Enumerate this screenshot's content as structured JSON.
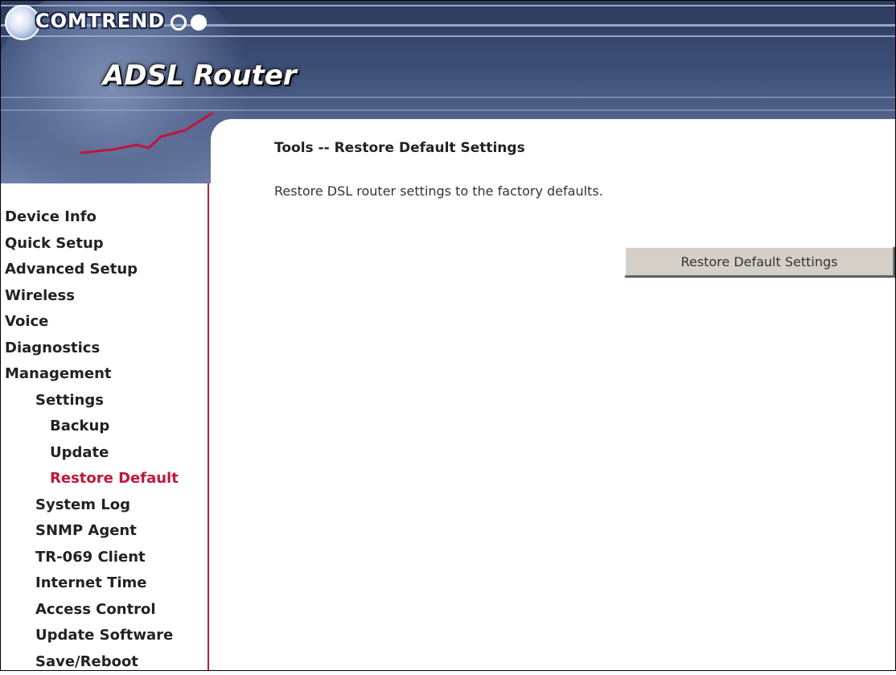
{
  "header": {
    "brand": "COMTREND",
    "product": "ADSL Router"
  },
  "page": {
    "title": "Tools -- Restore Default Settings",
    "description": "Restore DSL router settings to the factory defaults.",
    "restore_button_label": "Restore Default Settings"
  },
  "sidebar": {
    "items": [
      {
        "label": "Device Info"
      },
      {
        "label": "Quick Setup"
      },
      {
        "label": "Advanced Setup"
      },
      {
        "label": "Wireless"
      },
      {
        "label": "Voice"
      },
      {
        "label": "Diagnostics"
      },
      {
        "label": "Management"
      },
      {
        "label": "Settings"
      },
      {
        "label": "Backup"
      },
      {
        "label": "Update"
      },
      {
        "label": "Restore Default"
      },
      {
        "label": "System Log"
      },
      {
        "label": "SNMP Agent"
      },
      {
        "label": "TR-069 Client"
      },
      {
        "label": "Internet Time"
      },
      {
        "label": "Access Control"
      },
      {
        "label": "Update Software"
      },
      {
        "label": "Save/Reboot"
      }
    ],
    "active_item": "Restore Default"
  },
  "colors": {
    "accent": "#c0163a",
    "banner": "#3c4d76",
    "button_face": "#d4d0c8"
  }
}
